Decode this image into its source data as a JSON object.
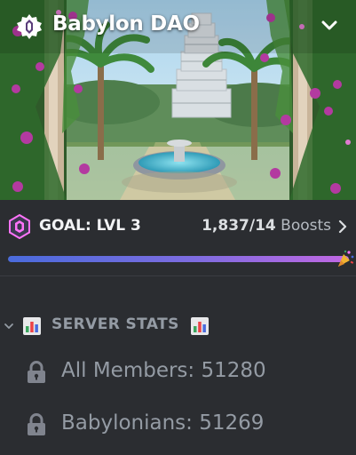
{
  "server": {
    "name": "Babylon DAO"
  },
  "boost_goal": {
    "label": "GOAL: LVL 3",
    "current": "1,837",
    "target": "/14",
    "unit": "Boosts",
    "progress_fraction": 1.0
  },
  "category": {
    "label": "SERVER STATS",
    "emoji": "bar-chart-icon"
  },
  "channels": [
    {
      "name": "All Members: 51280",
      "icon": "lock-icon"
    },
    {
      "name": "Babylonians: 51269",
      "icon": "lock-icon"
    }
  ],
  "colors": {
    "sidebar_bg": "#2b2d31",
    "progress_start": "#4a6bdc",
    "progress_end": "#c168e3",
    "muted_text": "#949ba4",
    "boost_pink": "#ff73fa"
  }
}
